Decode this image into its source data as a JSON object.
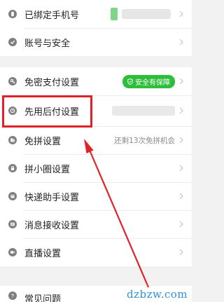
{
  "settings": {
    "items": [
      {
        "label": "已绑定手机号",
        "icon": "phone-icon"
      },
      {
        "label": "账号与安全",
        "icon": "shield-check-icon"
      },
      {
        "label": "免密支付设置",
        "icon": "key-icon",
        "badge": "安全有保障"
      },
      {
        "label": "先用后付设置",
        "icon": "clock-icon"
      },
      {
        "label": "免拼设置",
        "icon": "group-icon",
        "status": "还剩13次免拼机会"
      },
      {
        "label": "拼小圈设置",
        "icon": "lock-icon"
      },
      {
        "label": "快递助手设置",
        "icon": "package-icon"
      },
      {
        "label": "消息接收设置",
        "icon": "message-icon"
      },
      {
        "label": "直播设置",
        "icon": "live-icon"
      },
      {
        "label": "常见问题",
        "icon": "question-icon"
      }
    ]
  },
  "watermark": "dzbzw.com",
  "colors": {
    "badge": "#2dbf3c",
    "highlight": "#e0232b",
    "arrow": "#e0232b",
    "icon": "#7f7f7f"
  }
}
